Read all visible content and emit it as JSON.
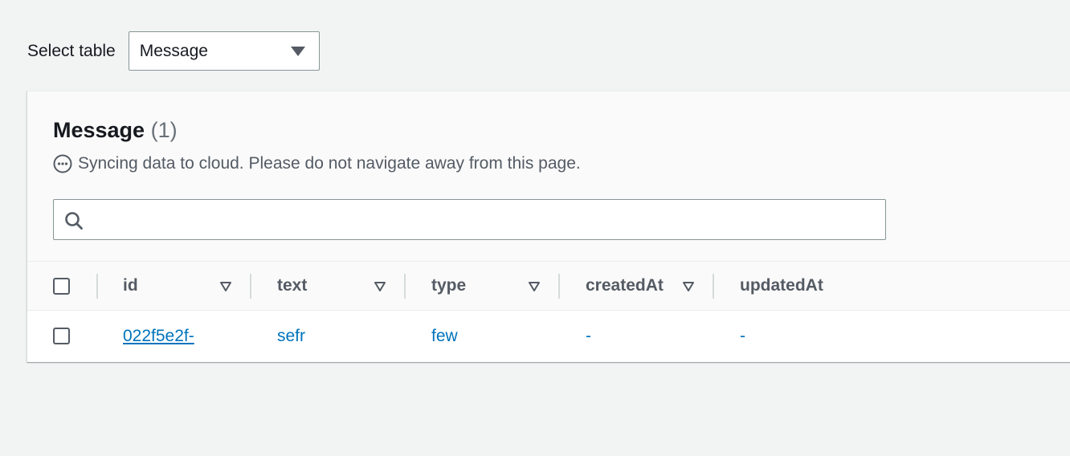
{
  "select_table": {
    "label": "Select table",
    "value": "Message"
  },
  "panel": {
    "title": "Message",
    "count": "(1)",
    "sync_message": "Syncing data to cloud. Please do not navigate away from this page."
  },
  "search": {
    "placeholder": "",
    "value": ""
  },
  "table": {
    "columns": [
      {
        "key": "id",
        "label": "id"
      },
      {
        "key": "text",
        "label": "text"
      },
      {
        "key": "type",
        "label": "type"
      },
      {
        "key": "createdAt",
        "label": "createdAt"
      },
      {
        "key": "updatedAt",
        "label": "updatedAt"
      }
    ],
    "rows": [
      {
        "id": "022f5e2f-",
        "text": "sefr",
        "type": "few",
        "createdAt": "-",
        "updatedAt": "-"
      }
    ]
  },
  "colors": {
    "link": "#0073bb",
    "header_text": "#545b64",
    "background": "#f2f3f3"
  }
}
